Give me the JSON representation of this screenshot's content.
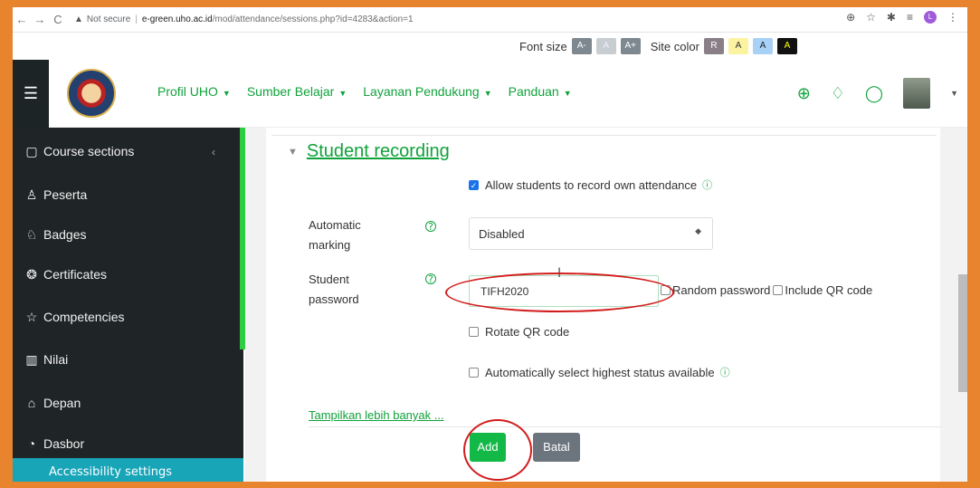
{
  "browser": {
    "security": "Not secure",
    "host": "e-green.uho.ac.id",
    "path": "/mod/attendance/sessions.php?id=4283&action=1"
  },
  "tools": {
    "font_size_label": "Font size",
    "font_buttons": [
      "A-",
      "A",
      "A+"
    ],
    "site_color_label": "Site color",
    "color_buttons": [
      "R",
      "A",
      "A",
      "A"
    ]
  },
  "navbar": {
    "menu": [
      "Profil UHO",
      "Sumber Belajar",
      "Layanan Pendukung",
      "Panduan"
    ]
  },
  "sidebar": {
    "items": [
      {
        "label": "Course sections",
        "icon": "folder-icon"
      },
      {
        "label": "Peserta",
        "icon": "users-icon"
      },
      {
        "label": "Badges",
        "icon": "badges-icon"
      },
      {
        "label": "Certificates",
        "icon": "certificate-icon"
      },
      {
        "label": "Competencies",
        "icon": "star-icon"
      },
      {
        "label": "Nilai",
        "icon": "grades-icon"
      },
      {
        "label": "Depan",
        "icon": "home-icon"
      },
      {
        "label": "Dasbor",
        "icon": "dashboard-icon"
      }
    ],
    "accessibility": "Accessibility settings"
  },
  "form": {
    "section_title": "Student recording",
    "allow_record_label": "Allow students to record own attendance",
    "automatic_marking_label": "Automatic marking",
    "automatic_marking_value": "Disabled",
    "student_password_label": "Student password",
    "student_password_value": "TIFH2020",
    "random_password_label": "Random password",
    "include_qr_label": "Include QR code",
    "rotate_qr_label": "Rotate QR code",
    "auto_select_label": "Automatically select highest status available",
    "show_more_link": "Tampilkan lebih banyak ...",
    "add_button": "Add",
    "cancel_button": "Batal"
  },
  "colors": {
    "accent": "#10a23b",
    "sidebar_bg": "#1f2426",
    "annotation": "#d21c1c",
    "frame": "#e8842e"
  }
}
